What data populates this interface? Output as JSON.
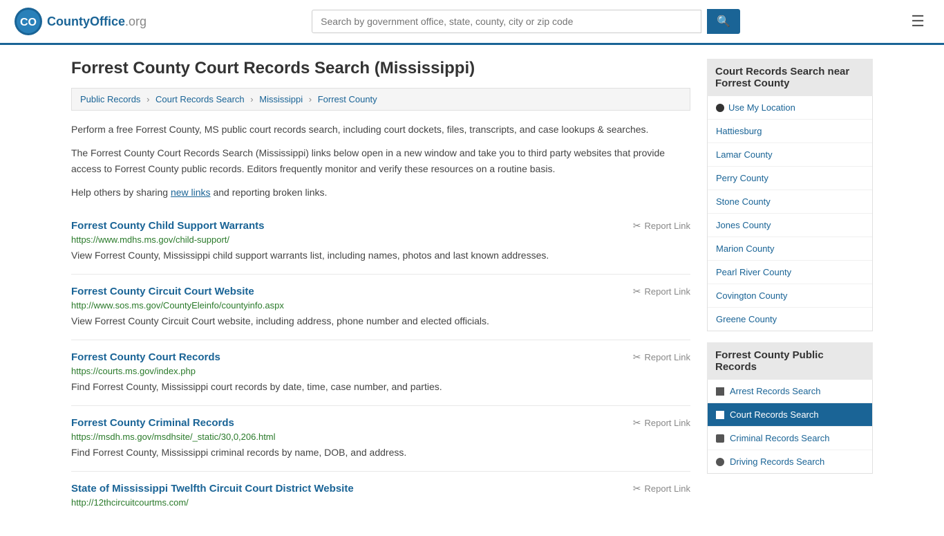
{
  "header": {
    "logo_text": "CountyOffice",
    "logo_suffix": ".org",
    "search_placeholder": "Search by government office, state, county, city or zip code",
    "search_value": ""
  },
  "page": {
    "title": "Forrest County Court Records Search (Mississippi)",
    "breadcrumb": [
      {
        "label": "Public Records",
        "href": "#"
      },
      {
        "label": "Court Records Search",
        "href": "#"
      },
      {
        "label": "Mississippi",
        "href": "#"
      },
      {
        "label": "Forrest County",
        "href": "#"
      }
    ],
    "desc1": "Perform a free Forrest County, MS public court records search, including court dockets, files, transcripts, and case lookups & searches.",
    "desc2": "The Forrest County Court Records Search (Mississippi) links below open in a new window and take you to third party websites that provide access to Forrest County public records. Editors frequently monitor and verify these resources on a routine basis.",
    "desc3_prefix": "Help others by sharing ",
    "desc3_link": "new links",
    "desc3_suffix": " and reporting broken links.",
    "records": [
      {
        "title": "Forrest County Child Support Warrants",
        "url": "https://www.mdhs.ms.gov/child-support/",
        "desc": "View Forrest County, Mississippi child support warrants list, including names, photos and last known addresses.",
        "report_label": "Report Link"
      },
      {
        "title": "Forrest County Circuit Court Website",
        "url": "http://www.sos.ms.gov/CountyEleinfo/countyinfo.aspx",
        "desc": "View Forrest County Circuit Court website, including address, phone number and elected officials.",
        "report_label": "Report Link"
      },
      {
        "title": "Forrest County Court Records",
        "url": "https://courts.ms.gov/index.php",
        "desc": "Find Forrest County, Mississippi court records by date, time, case number, and parties.",
        "report_label": "Report Link"
      },
      {
        "title": "Forrest County Criminal Records",
        "url": "https://msdh.ms.gov/msdhsite/_static/30,0,206.html",
        "desc": "Find Forrest County, Mississippi criminal records by name, DOB, and address.",
        "report_label": "Report Link"
      },
      {
        "title": "State of Mississippi Twelfth Circuit Court District Website",
        "url": "http://12thcircuitcourtms.com/",
        "desc": "",
        "report_label": "Report Link"
      }
    ]
  },
  "sidebar": {
    "nearby_title": "Court Records Search near Forrest County",
    "nearby_links": [
      {
        "label": "Use My Location"
      },
      {
        "label": "Hattiesburg"
      },
      {
        "label": "Lamar County"
      },
      {
        "label": "Perry County"
      },
      {
        "label": "Stone County"
      },
      {
        "label": "Jones County"
      },
      {
        "label": "Marion County"
      },
      {
        "label": "Pearl River County"
      },
      {
        "label": "Covington County"
      },
      {
        "label": "Greene County"
      }
    ],
    "public_records_title": "Forrest County Public Records",
    "public_records_links": [
      {
        "label": "Arrest Records Search",
        "active": false
      },
      {
        "label": "Court Records Search",
        "active": true
      },
      {
        "label": "Criminal Records Search",
        "active": false
      },
      {
        "label": "Driving Records Search",
        "active": false
      }
    ]
  }
}
